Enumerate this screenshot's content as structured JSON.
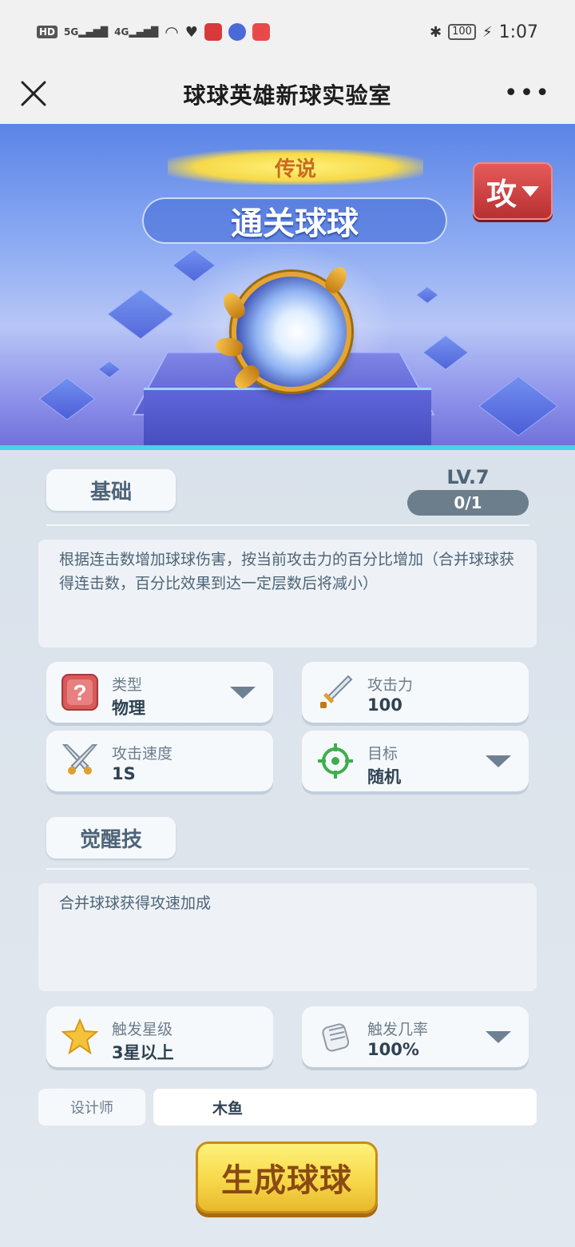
{
  "status_bar": {
    "hd": "HD",
    "sim1": "5G",
    "sim2": "4G",
    "battery": "100",
    "time": "1:07"
  },
  "nav": {
    "title": "球球英雄新球实验室"
  },
  "hero": {
    "rarity": "传说",
    "ball_name": "通关球球",
    "attack_badge": "攻"
  },
  "basic": {
    "tab_label": "基础",
    "level": "LV.7",
    "progress_text": "0/1",
    "progress": 0,
    "description": "根据连击数增加球球伤害，按当前攻击力的百分比增加（合并球球获得连击数，百分比效果到达一定层数后将减小）"
  },
  "stats": {
    "type": {
      "label": "类型",
      "value": "物理"
    },
    "attack": {
      "label": "攻击力",
      "value": "100"
    },
    "speed": {
      "label": "攻击速度",
      "value": "1S"
    },
    "target": {
      "label": "目标",
      "value": "随机"
    }
  },
  "awaken": {
    "tab_label": "觉醒技",
    "description": "合并球球获得攻速加成",
    "trigger_star": {
      "label": "触发星级",
      "value": "3星以上"
    },
    "trigger_rate": {
      "label": "触发几率",
      "value": "100%"
    }
  },
  "designer": {
    "label": "设计师",
    "value": "木鱼"
  },
  "generate_button": "生成球球",
  "colors": {
    "accent_gold": "#f7d84a",
    "attack_red": "#c94040",
    "hero_blue": "#5b84e6",
    "label_slate": "#4e6478"
  }
}
